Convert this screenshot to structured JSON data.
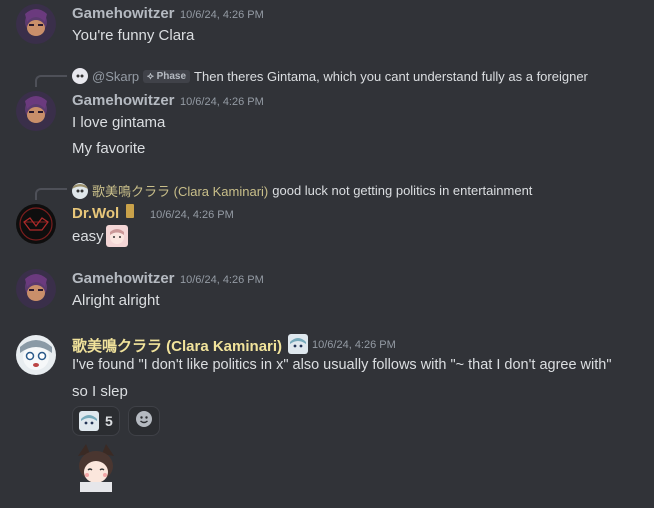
{
  "messages": [
    {
      "author": "Gamehowitzer",
      "timestamp": "10/6/24, 4:26 PM",
      "lines": [
        "You're funny Clara"
      ]
    },
    {
      "reply": {
        "author": "@Skarp",
        "tag": "Phase",
        "text": "Then theres Gintama, which you cant understand fully as a foreigner"
      },
      "author": "Gamehowitzer",
      "timestamp": "10/6/24, 4:26 PM",
      "lines": [
        "I love gintama",
        "My favorite"
      ]
    },
    {
      "reply": {
        "author": "歌美鳴クララ (Clara Kaminari)",
        "text": "good luck not getting politics in entertainment"
      },
      "author": "Dr.Wol",
      "timestamp": "10/6/24, 4:26 PM",
      "lines": [
        "easy"
      ]
    },
    {
      "author": "Gamehowitzer",
      "timestamp": "10/6/24, 4:26 PM",
      "lines": [
        "Alright alright"
      ]
    },
    {
      "author": "歌美鳴クララ (Clara Kaminari)",
      "timestamp": "10/6/24, 4:26 PM",
      "lines": [
        "I've found \"I don't like politics in x\" also usually follows with \"~ that I don't agree with\"",
        "so I slep"
      ],
      "reaction": {
        "count": "5"
      }
    }
  ],
  "colors": {
    "background": "#313338",
    "username_default": "#b5bac1",
    "username_drwol": "#e8c77a",
    "username_clara": "#f1e39b",
    "timestamp": "#949ba4",
    "text": "#dbdee1"
  },
  "icons": {
    "reply_tag": "phase-tag-icon",
    "drwol_badge": "badge-icon",
    "add_reaction": "add-reaction-icon"
  }
}
